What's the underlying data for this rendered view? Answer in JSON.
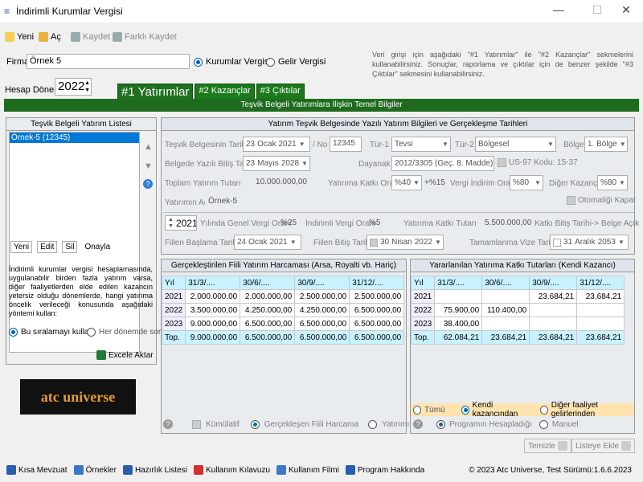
{
  "window": {
    "title": "İndirimli Kurumlar Vergisi",
    "minimize": "—",
    "maximize": "☐",
    "close": "✕"
  },
  "toolbar": {
    "new": "Yeni",
    "open": "Aç",
    "save": "Kaydet",
    "save_as": "Farklı Kaydet"
  },
  "firm": {
    "label": "Firma",
    "value": "Örnek 5",
    "radio_corporate": "Kurumlar Vergisi",
    "radio_income": "Gelir Vergisi",
    "selected": "corporate"
  },
  "period": {
    "label": "Hesap Dönemi",
    "value": "2022"
  },
  "info_text": "Veri girişi için aşağıdaki \"#1 Yatırımlar\" ile \"#2 Kazançlar\" sekmelerini kullanabilirsiniz. Sonuçlar, raporlama ve çıktılar için de benzer şekilde \"#3 Çıktılar\" sekmesini kullanabilirsiniz.",
  "tabs": [
    "#1 Yatırımlar",
    "#2 Kazançlar",
    "#3 Çıktılar"
  ],
  "section_title": "Teşvik Belgeli Yatırımlara İlişkin Temel Bilgiler",
  "left_panel": {
    "title": "Teşvik Belgeli Yatırım Listesi",
    "items": [
      "Örnek-5 (12345)"
    ],
    "btn_new": "Yeni",
    "btn_edit": "Edit",
    "btn_delete": "Sil",
    "btn_approve": "Onayla",
    "note": "İndirimli kurumlar vergisi hesaplamasında, uygulanabilir birden fazla yatırım varsa, diğer faaliyetlerden elde edilen kazancın yetersiz olduğu dönemlerde, hangi yatırıma öncelik verileceği konusunda aşağıdaki yöntemi kullan:",
    "radio_order": "Bu sıralamayı kullan",
    "radio_each": "Her dönemde sor",
    "excel": "Excele Aktar",
    "logo": "atc universe"
  },
  "detail": {
    "title": "Yatırım Teşvik Belgesinde Yazılı Yatırım Bilgileri ve Gerçekleşme Tarihleri",
    "cert_date_label": "Teşvik Belgesinin Tarihi",
    "cert_day": "23",
    "cert_month": "Ocak",
    "cert_year": "2021",
    "no_label": "/ No",
    "no_value": "12345",
    "type1_label": "Tür-1",
    "type1_value": "Tevsi",
    "type2_label": "Tür-2",
    "type2_value": "Bölgesel",
    "region_label": "Bölge",
    "region_value": "1. Bölge",
    "end_label": "Belgede Yazılı Bitiş Tarihi",
    "end_day": "23",
    "end_month": "Mayıs",
    "end_year": "2028",
    "basis_label": "Dayanak",
    "basis_value": "2012/3305 (Geç. 8. Madde)",
    "us97": "US-97 Kodu: 15-37",
    "total_label": "Toplam Yatırım Tutarı",
    "total_value": "10.000.000,00",
    "contrib_label": "Yatırıma Katkı Oranı",
    "contrib_value": "%40",
    "contrib_plus": "+%15",
    "discount_label": "Vergi İndirim Oranı",
    "discount_value": "%80",
    "other_label": "Diğer Kazanç",
    "other_value": "%80",
    "auto_close": "Otomatiği Kapat",
    "name_label": "Yatırımın Adı",
    "name_value": "Örnek-5",
    "year_value": "2021",
    "gen_tax_label": "Yılında Genel Vergi Oranı",
    "gen_tax_value": "%25",
    "red_tax_label": "İndirimli Vergi Oranı",
    "red_tax_value": "%5",
    "contrib_amount_label": "Yatırıma Katkı Tutarı",
    "contrib_amount_value": "5.500.000,00",
    "contrib_end_label": "Katkı Bitiş Tarihi-> Belge Açık",
    "start_label": "Fiilen Başlama Tarihi->",
    "start_day": "24",
    "start_month": "Ocak",
    "start_year": "2021",
    "actual_end_label": "Fiilen Bitiş Tarihi",
    "actual_end_day": "30",
    "actual_end_month": "Nisan",
    "actual_end_year": "2022",
    "visa_label": "Tamamlanma Vize Tarihi",
    "visa_day": "31",
    "visa_month": "Aralık",
    "visa_year": "2053"
  },
  "spend_table": {
    "title": "Gerçekleştirilen Fiili Yatırım Harcaması (Arsa, Royalti vb. Hariç)",
    "headers": [
      "Yıl",
      "31/3/....",
      "30/6/....",
      "30/9/....",
      "31/12/...."
    ],
    "rows": [
      [
        "2021",
        "2.000.000,00",
        "2.000.000,00",
        "2.500.000,00",
        "2.500.000,00"
      ],
      [
        "2022",
        "3.500.000,00",
        "4.250.000,00",
        "4.250.000,00",
        "6.500.000,00"
      ],
      [
        "2023",
        "9.000.000,00",
        "6.500.000,00",
        "6.500.000,00",
        "6.500.000,00"
      ],
      [
        "Top.",
        "9.000.000,00",
        "6.500.000,00",
        "6.500.000,00",
        "6.500.000,00"
      ]
    ],
    "opt_cumulative": "Kümülatif",
    "opt_actual": "Gerçekleşen Fiili Harcama",
    "opt_gain": "Yatırımın Kazancı"
  },
  "benefit_table": {
    "title": "Yararlanılan Yatırıma Katkı Tutarları (Kendi Kazancı)",
    "headers": [
      "Yıl",
      "31/3/....",
      "30/6/....",
      "30/9/....",
      "31/12/...."
    ],
    "rows": [
      [
        "2021",
        "",
        "",
        "23.684,21",
        "23.684,21"
      ],
      [
        "2022",
        "75.900,00",
        "110.400,00",
        "",
        ""
      ],
      [
        "2023",
        "38.400,00",
        "",
        "",
        ""
      ],
      [
        "Top.",
        "62.084,21",
        "23.684,21",
        "23.684,21",
        "23.684,21"
      ]
    ],
    "opt_all": "Tümü",
    "opt_own": "Kendi kazancından",
    "opt_other": "Diğer faaliyet gelirlerinden",
    "opt_program": "Programın Hesapladığı",
    "opt_manual": "Manuel"
  },
  "actions": {
    "clear": "Temizle",
    "add_list": "Listeye Ekle"
  },
  "status": {
    "items": [
      "Kısa Mevzuat",
      "Örnekler",
      "Hazırlık Listesi",
      "Kullanım Kılavuzu",
      "Kullanım Filmi",
      "Program Hakkında"
    ],
    "version": "© 2023 Atc Universe, Test Sürümü:1.6.6.2023"
  },
  "colors": {
    "tab_green": "#1b7a1b",
    "bar_green": "#1e6b1e",
    "grid_head": "#c8f2ff",
    "selected_list": "#0078d7"
  }
}
